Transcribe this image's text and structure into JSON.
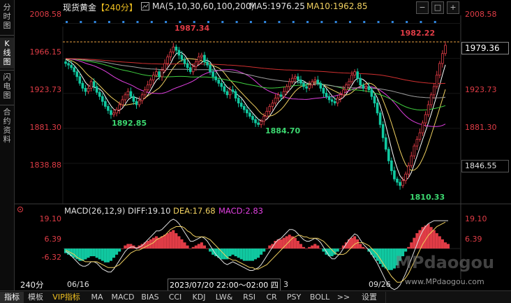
{
  "side_tabs": [
    {
      "label": "分时图",
      "active": false
    },
    {
      "label": "K线图",
      "active": true
    },
    {
      "label": "闪电图",
      "active": false
    },
    {
      "label": "合约资料",
      "active": false
    }
  ],
  "header": {
    "instrument": "现货黄金",
    "period": "【240分】",
    "ma_params": "MA(5,10,30,60,100,200)",
    "ma5": "MA5:1976.25",
    "ma10": "MA10:1962.85"
  },
  "price_axis": {
    "ticks": [
      {
        "label": "2008.58",
        "value": 2008.58
      },
      {
        "label": "1966.15",
        "value": 1966.15
      },
      {
        "label": "1923.73",
        "value": 1923.73
      },
      {
        "label": "1881.30",
        "value": 1881.3
      },
      {
        "label": "1838.88",
        "value": 1838.88
      }
    ],
    "current_price": "1979.36",
    "reference_price": "1846.55"
  },
  "annotations": {
    "high1": "1987.34",
    "high2": "1982.22",
    "low1": "1892.85",
    "low2": "1884.70",
    "low3": "1810.33"
  },
  "macd": {
    "title": "MACD(26,12,9)",
    "diff": "DIFF:19.10",
    "dea": "DEA:17.68",
    "macd": "MACD:2.83",
    "ticks": [
      {
        "label": "19.10",
        "value": 19.1
      },
      {
        "label": "6.39",
        "value": 6.39
      },
      {
        "label": "-6.32",
        "value": -6.32
      }
    ]
  },
  "time_axis": {
    "period_button": "240分",
    "date1": "06/16",
    "crosshair_time": "2023/07/20 22:00～02:00 四",
    "date3": "09/26",
    "cut_label": "3"
  },
  "watermark": {
    "brand": "MPdaogou",
    "url": "www.MPdaogou.com"
  },
  "bottom_tabs": [
    "指标",
    "模板",
    "VIP指标",
    "MA",
    "MACD",
    "BIAS",
    "CCI",
    "KDJ",
    "LW&",
    "RSI",
    "CR",
    "PSY",
    "BOLL",
    ">>",
    "设置"
  ],
  "window_buttons": [
    "−",
    "□",
    "+"
  ],
  "colors": {
    "up": "#e03c46",
    "down": "#10c8a0",
    "ma5": "#ffffff",
    "ma10": "#f0d060",
    "ma30": "#e040e0",
    "ma60": "#40d040",
    "ma100": "#a0a0a0",
    "ma200": "#d03030",
    "low_label": "#3cd870",
    "bg": "#000000"
  },
  "chart_data": {
    "type": "candlestick",
    "ylim": [
      1800,
      2020
    ],
    "closes": [
      1960,
      1958,
      1955,
      1950,
      1944,
      1936,
      1930,
      1926,
      1930,
      1938,
      1932,
      1925,
      1920,
      1914,
      1908,
      1903,
      1898,
      1900,
      1904,
      1910,
      1916,
      1922,
      1926,
      1920,
      1914,
      1910,
      1915,
      1922,
      1928,
      1934,
      1940,
      1946,
      1950,
      1944,
      1952,
      1960,
      1968,
      1974,
      1980,
      1976,
      1970,
      1965,
      1960,
      1955,
      1950,
      1956,
      1962,
      1968,
      1970,
      1962,
      1958,
      1950,
      1944,
      1940,
      1936,
      1932,
      1926,
      1922,
      1928,
      1926,
      1918,
      1912,
      1908,
      1904,
      1900,
      1896,
      1892,
      1888,
      1886,
      1890,
      1896,
      1902,
      1908,
      1912,
      1918,
      1922,
      1920,
      1926,
      1932,
      1938,
      1942,
      1944,
      1940,
      1936,
      1932,
      1930,
      1934,
      1938,
      1940,
      1936,
      1930,
      1924,
      1920,
      1916,
      1914,
      1912,
      1918,
      1922,
      1928,
      1934,
      1938,
      1946,
      1950,
      1942,
      1934,
      1930,
      1932,
      1928,
      1920,
      1912,
      1900,
      1886,
      1870,
      1856,
      1842,
      1830,
      1820,
      1816,
      1812,
      1818,
      1826,
      1836,
      1848,
      1860,
      1868,
      1876,
      1888,
      1898,
      1910,
      1922,
      1932,
      1946,
      1960,
      1972,
      1982
    ],
    "macd_hist": [
      -3,
      -4,
      -5,
      -6,
      -7,
      -8,
      -8,
      -7,
      -6,
      -5,
      -5,
      -6,
      -7,
      -8,
      -9,
      -9,
      -8,
      -6,
      -4,
      -2,
      0,
      2,
      3,
      3,
      2,
      1,
      2,
      3,
      4,
      5,
      6,
      7,
      8,
      7,
      8,
      9,
      10,
      11,
      12,
      10,
      8,
      6,
      4,
      2,
      0,
      1,
      2,
      3,
      4,
      2,
      0,
      -2,
      -4,
      -5,
      -6,
      -7,
      -7,
      -7,
      -5,
      -4,
      -5,
      -6,
      -7,
      -8,
      -8,
      -8,
      -8,
      -7,
      -6,
      -4,
      -2,
      0,
      2,
      3,
      5,
      6,
      6,
      7,
      8,
      9,
      8,
      7,
      5,
      3,
      1,
      0,
      1,
      2,
      3,
      2,
      0,
      -2,
      -4,
      -5,
      -5,
      -4,
      -2,
      0,
      2,
      4,
      6,
      7,
      8,
      6,
      3,
      1,
      0,
      -2,
      -4,
      -6,
      -8,
      -10,
      -12,
      -13,
      -14,
      -14,
      -13,
      -11,
      -8,
      -5,
      -2,
      1,
      4,
      7,
      10,
      12,
      14,
      15,
      16,
      14,
      12,
      10,
      8,
      6,
      4,
      3
    ],
    "diff": [
      -2,
      -3,
      -5,
      -7,
      -9,
      -11,
      -12,
      -12,
      -11,
      -9,
      -9,
      -10,
      -12,
      -14,
      -15,
      -16,
      -16,
      -14,
      -11,
      -8,
      -5,
      -2,
      0,
      1,
      1,
      0,
      1,
      2,
      4,
      6,
      8,
      10,
      12,
      12,
      13,
      15,
      17,
      19,
      20,
      19,
      17,
      14,
      11,
      8,
      5,
      5,
      6,
      7,
      8,
      7,
      5,
      2,
      -1,
      -4,
      -6,
      -8,
      -10,
      -11,
      -10,
      -9,
      -10,
      -11,
      -12,
      -13,
      -14,
      -15,
      -15,
      -14,
      -13,
      -11,
      -8,
      -5,
      -2,
      1,
      4,
      6,
      7,
      9,
      11,
      13,
      13,
      12,
      10,
      8,
      6,
      5,
      5,
      6,
      7,
      6,
      4,
      1,
      -2,
      -5,
      -7,
      -7,
      -5,
      -3,
      0,
      3,
      6,
      8,
      10,
      9,
      6,
      3,
      1,
      -1,
      -4,
      -7,
      -10,
      -14,
      -18,
      -22,
      -25,
      -27,
      -28,
      -27,
      -25,
      -21,
      -17,
      -12,
      -7,
      -2,
      3,
      8,
      12,
      15,
      17,
      18,
      19,
      19,
      19,
      19,
      19,
      19
    ],
    "dea": [
      -1,
      -2,
      -3,
      -4,
      -6,
      -7,
      -8,
      -9,
      -9,
      -9,
      -9,
      -9,
      -10,
      -11,
      -12,
      -13,
      -13,
      -13,
      -12,
      -11,
      -9,
      -7,
      -5,
      -3,
      -2,
      -1,
      -1,
      0,
      1,
      2,
      3,
      4,
      6,
      7,
      8,
      9,
      11,
      13,
      14,
      15,
      15,
      15,
      14,
      12,
      11,
      9,
      8,
      8,
      8,
      8,
      7,
      6,
      4,
      2,
      0,
      -2,
      -4,
      -6,
      -7,
      -8,
      -8,
      -9,
      -10,
      -11,
      -12,
      -13,
      -13,
      -14,
      -14,
      -13,
      -12,
      -11,
      -9,
      -7,
      -5,
      -3,
      -1,
      1,
      3,
      5,
      7,
      8,
      9,
      9,
      8,
      8,
      7,
      7,
      7,
      7,
      6,
      5,
      3,
      1,
      -1,
      -3,
      -4,
      -4,
      -4,
      -3,
      -1,
      1,
      3,
      4,
      4,
      4,
      3,
      2,
      0,
      -2,
      -4,
      -7,
      -10,
      -13,
      -16,
      -19,
      -21,
      -23,
      -23,
      -22,
      -20,
      -17,
      -13,
      -9,
      -5,
      -1,
      3,
      6,
      9,
      11,
      13,
      15,
      16,
      17,
      18
    ]
  }
}
